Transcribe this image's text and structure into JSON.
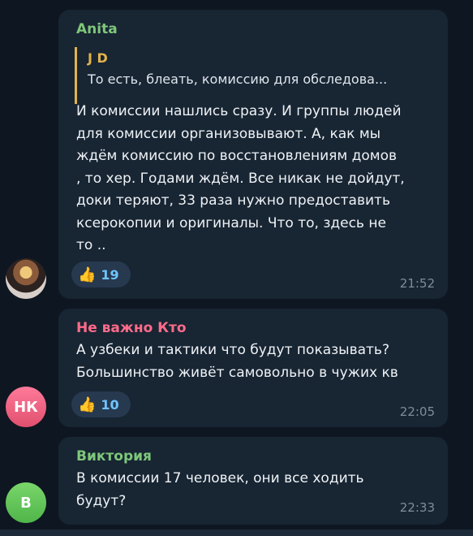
{
  "messages": [
    {
      "sender": "Anita",
      "sender_color": "#7ec77a",
      "reply_quote": {
        "author": "J D",
        "text": "То есть, блеать, комиссию для обследова..."
      },
      "text": "И комиссии нашлись сразу. И группы людей\nдля комиссии организовывают.  А, как мы\nждём комиссию по восстановлениям домов\n, то хер. Годами ждём. Все никак не дойдут,\nдоки теряют, 33 раза нужно предоставить\nксерокопии и оригиналы.   Что то, здесь не\nто ..",
      "reaction": {
        "emoji": "👍",
        "count": "19"
      },
      "time": "21:52",
      "avatar": "photo"
    },
    {
      "sender": "Не важно Кто",
      "sender_color": "#ff6b8a",
      "text": "А узбеки и тактики что будут показывать?\nБольшинство живёт самовольно в чужих кв",
      "reaction": {
        "emoji": "👍",
        "count": "10"
      },
      "time": "22:05",
      "avatar": "НК"
    },
    {
      "sender": "Виктория",
      "sender_color": "#7ec77a",
      "text": "В комиссии 17 человек, они все ходить\nбудут?",
      "time": "22:33",
      "avatar": "В"
    }
  ]
}
